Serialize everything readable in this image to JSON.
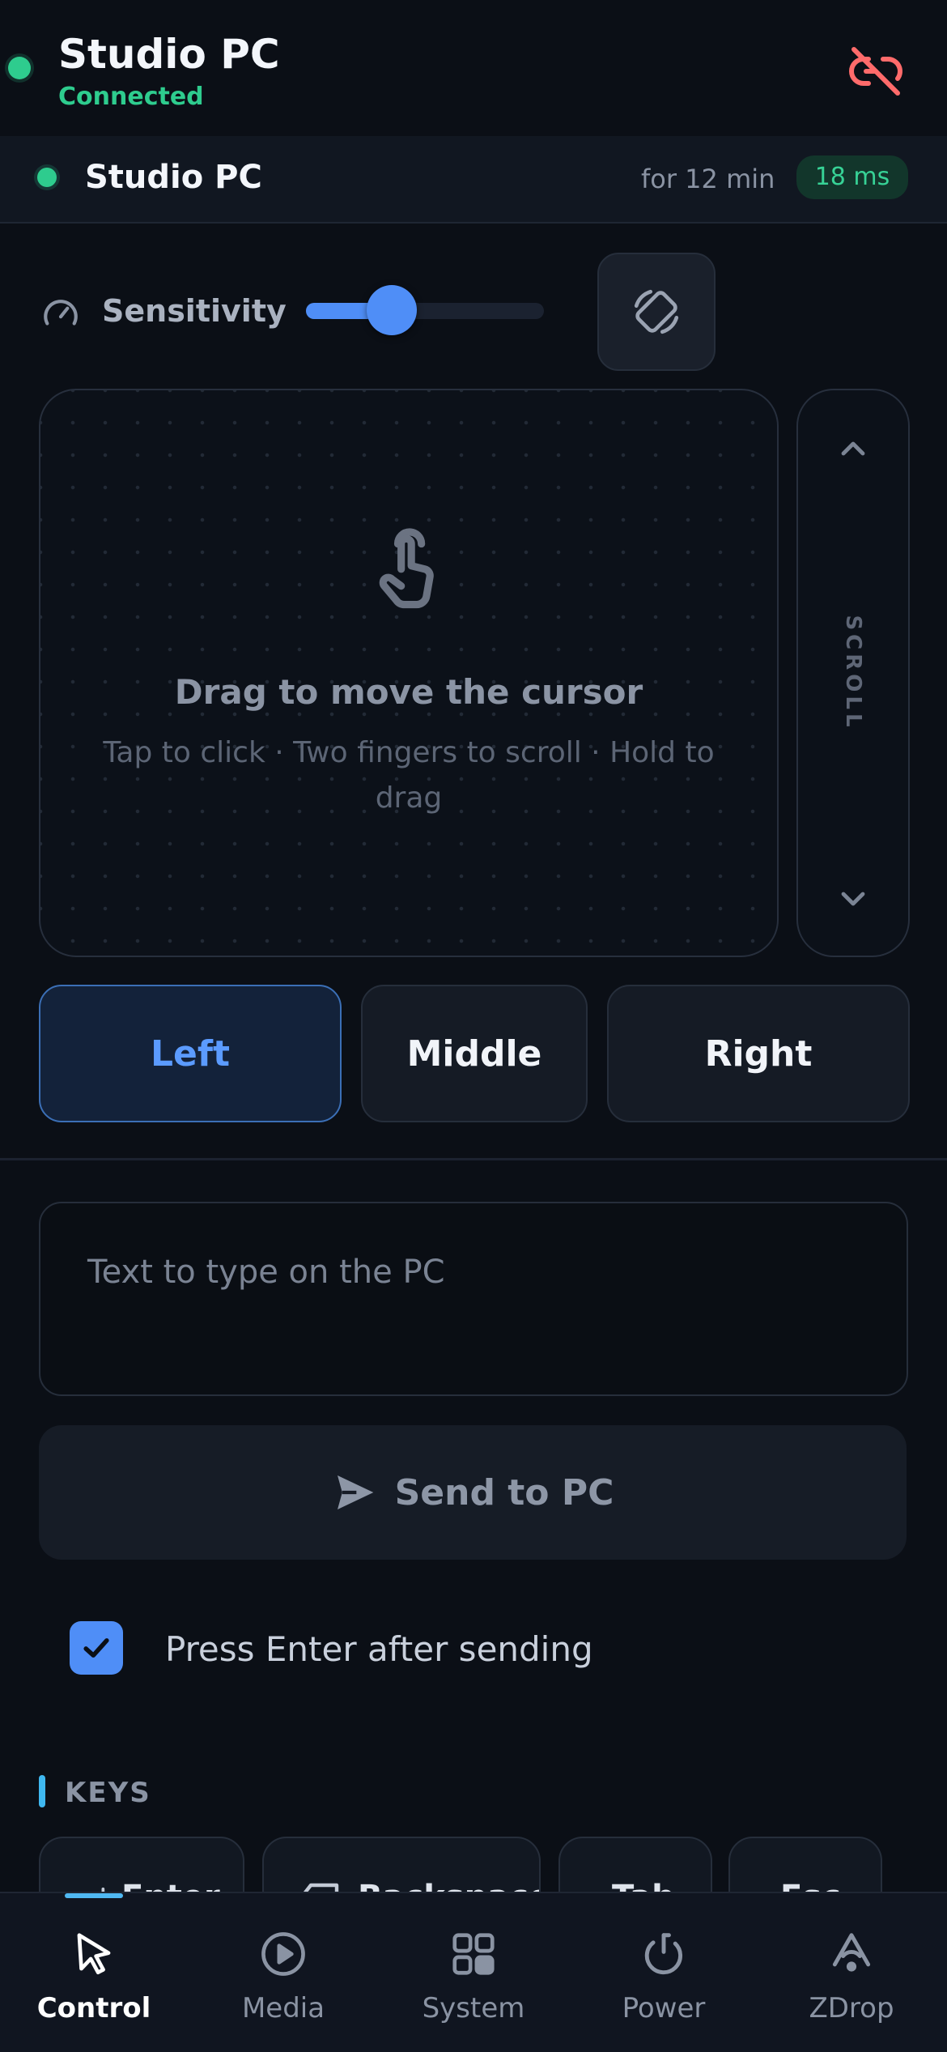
{
  "header": {
    "device_name": "Studio PC",
    "status": "Connected",
    "disconnect_icon": "link-off-icon",
    "status_color": "#2ecc8e",
    "disconnect_color": "#ff6b6b"
  },
  "connection": {
    "device_name": "Studio PC",
    "duration": "for 12 min",
    "latency": "18 ms"
  },
  "controls": {
    "sensitivity_label": "Sensitivity",
    "sensitivity_level": 0.36,
    "rotate_icon": "screen-rotate-icon"
  },
  "touchpad": {
    "title": "Drag to move the cursor",
    "hint": "Tap to click · Two fingers to scroll · Hold to drag",
    "scroll_label": "SCROLL"
  },
  "mouse_buttons": [
    {
      "label": "Left",
      "active": true
    },
    {
      "label": "Middle",
      "active": false
    },
    {
      "label": "Right",
      "active": false
    }
  ],
  "typing": {
    "placeholder": "Text to type on the PC",
    "send_label": "Send to PC",
    "enter_label": "Press Enter after sending",
    "enter_checked": true
  },
  "keys": {
    "title": "KEYS",
    "chips": [
      "Enter",
      "Backspace",
      "Tab",
      "Esc"
    ]
  },
  "tabs": [
    {
      "label": "Control",
      "icon": "cursor-icon",
      "active": true
    },
    {
      "label": "Media",
      "icon": "play-circle-icon",
      "active": false
    },
    {
      "label": "System",
      "icon": "grid-icon",
      "active": false
    },
    {
      "label": "Power",
      "icon": "power-icon",
      "active": false
    },
    {
      "label": "ZDrop",
      "icon": "zdrop-icon",
      "active": false
    }
  ],
  "colors": {
    "accent": "#4f8ef7",
    "background": "#0b0f16",
    "latency_bg": "#12362b"
  }
}
